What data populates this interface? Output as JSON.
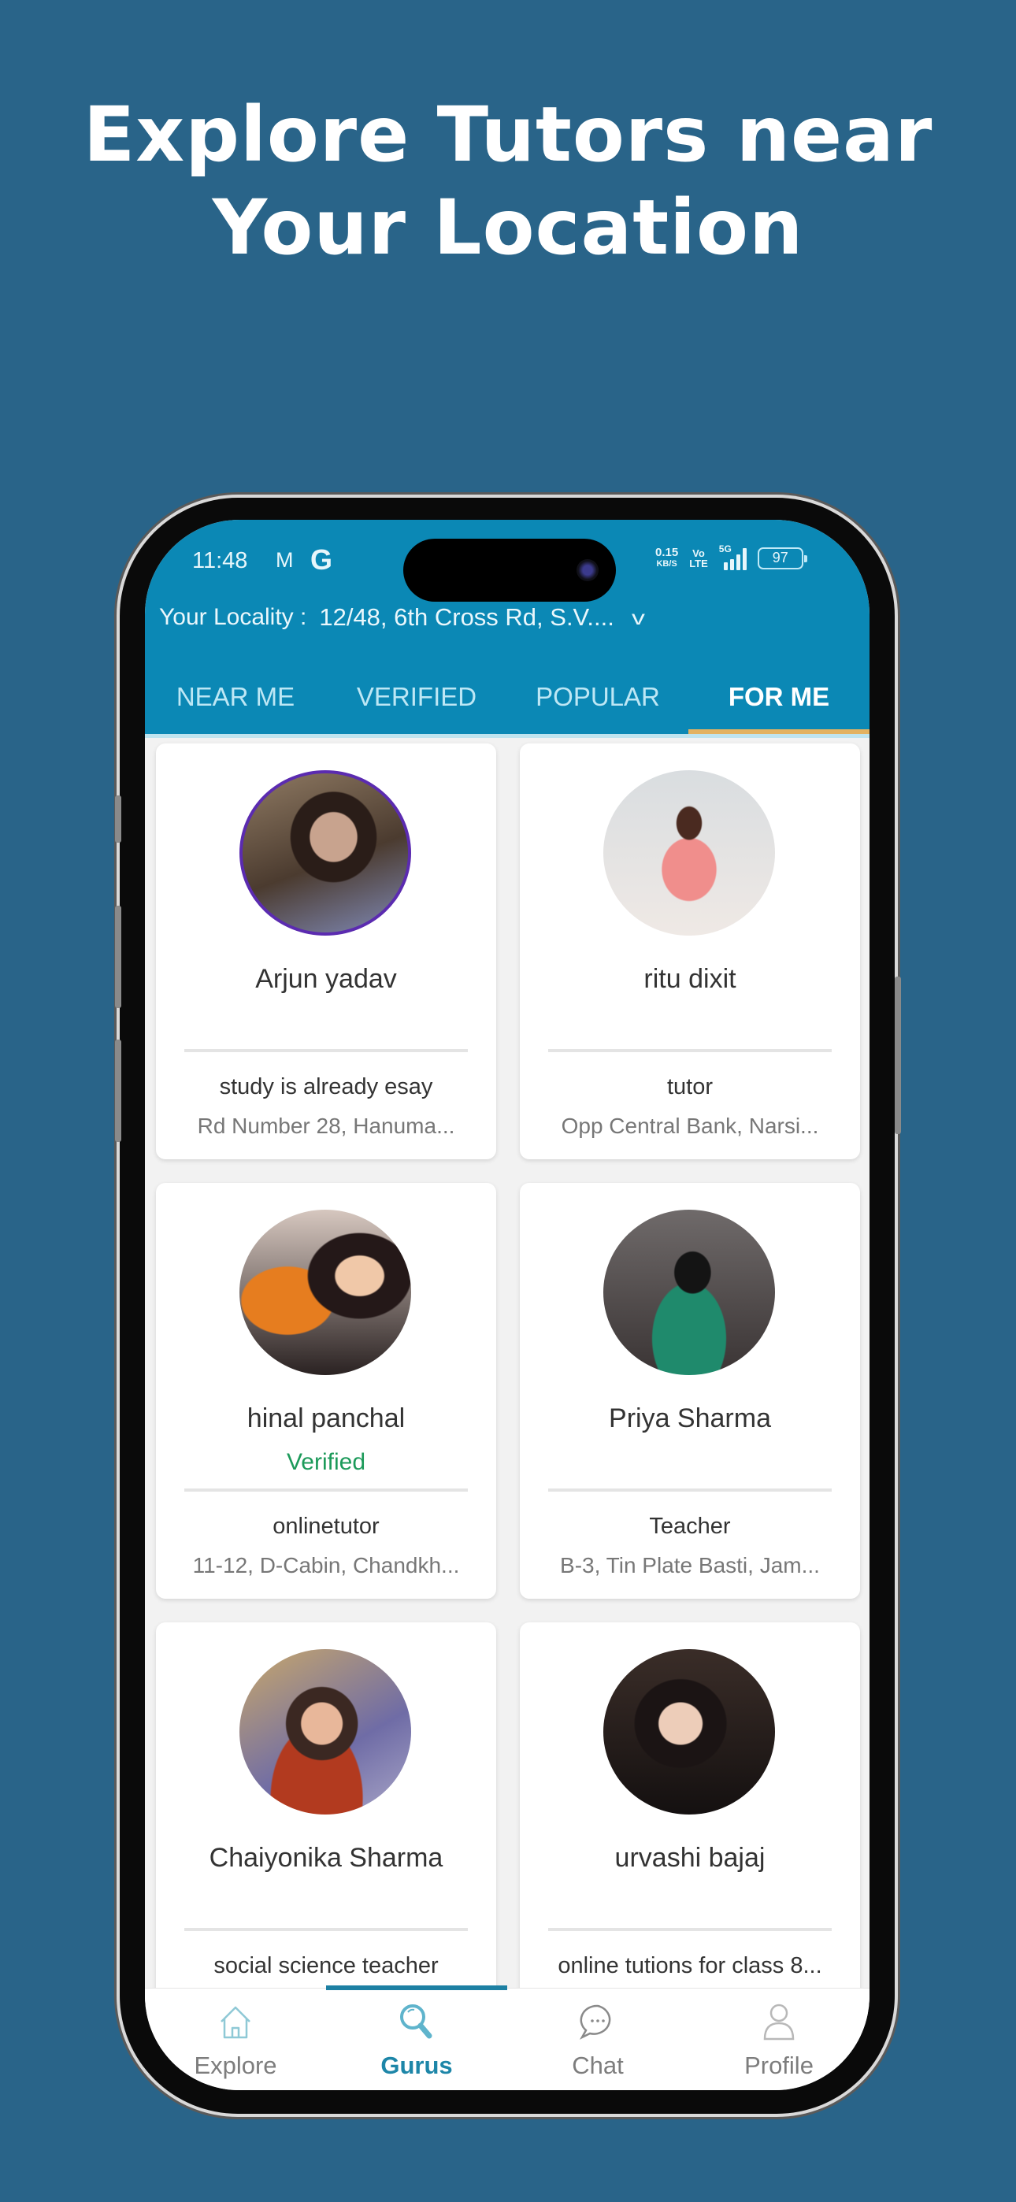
{
  "headline": {
    "line1": "Explore Tutors near",
    "line2": "Your Location"
  },
  "status_bar": {
    "time": "11:48",
    "left_icons": [
      "gmail-icon",
      "google-icon"
    ],
    "gmail_glyph": "M",
    "google_glyph": "G",
    "net_speed_value": "0.15",
    "net_speed_unit": "KB/S",
    "volte_top": "Vo",
    "volte_bottom": "LTE",
    "network": "5G",
    "battery": "97"
  },
  "header": {
    "locality_label": "Your Locality :",
    "locality_value": "12/48, 6th Cross Rd, S.V....",
    "dropdown_glyph": "v",
    "accent_color": "#0b88b5"
  },
  "tabs": [
    {
      "label": "NEAR ME",
      "active": false
    },
    {
      "label": "VERIFIED",
      "active": false
    },
    {
      "label": "POPULAR",
      "active": false
    },
    {
      "label": "FOR ME",
      "active": true
    }
  ],
  "tutors": [
    {
      "name": "Arjun yadav",
      "verified": "",
      "title": "study is already esay",
      "address": "Rd Number 28, Hanuma..."
    },
    {
      "name": "ritu dixit",
      "verified": "",
      "title": "tutor",
      "address": "Opp Central Bank, Narsi..."
    },
    {
      "name": "hinal panchal",
      "verified": "Verified",
      "title": "onlinetutor",
      "address": "11-12, D-Cabin, Chandkh..."
    },
    {
      "name": "Priya Sharma",
      "verified": "",
      "title": "Teacher",
      "address": "B-3, Tin Plate Basti, Jam..."
    },
    {
      "name": "Chaiyonika Sharma",
      "verified": "",
      "title": "social science teacher",
      "address": ""
    },
    {
      "name": "urvashi bajaj",
      "verified": "",
      "title": "online tutions for class 8...",
      "address": ""
    }
  ],
  "bottom_nav": [
    {
      "label": "Explore",
      "icon": "home-icon",
      "active": false
    },
    {
      "label": "Gurus",
      "icon": "search-icon",
      "active": true
    },
    {
      "label": "Chat",
      "icon": "chat-icon",
      "active": false
    },
    {
      "label": "Profile",
      "icon": "profile-icon",
      "active": false
    }
  ],
  "colors": {
    "background": "#296489",
    "verified": "#1c9a5a",
    "active_tab_indicator": "#e3b261",
    "active_nav": "#1d86a8"
  }
}
